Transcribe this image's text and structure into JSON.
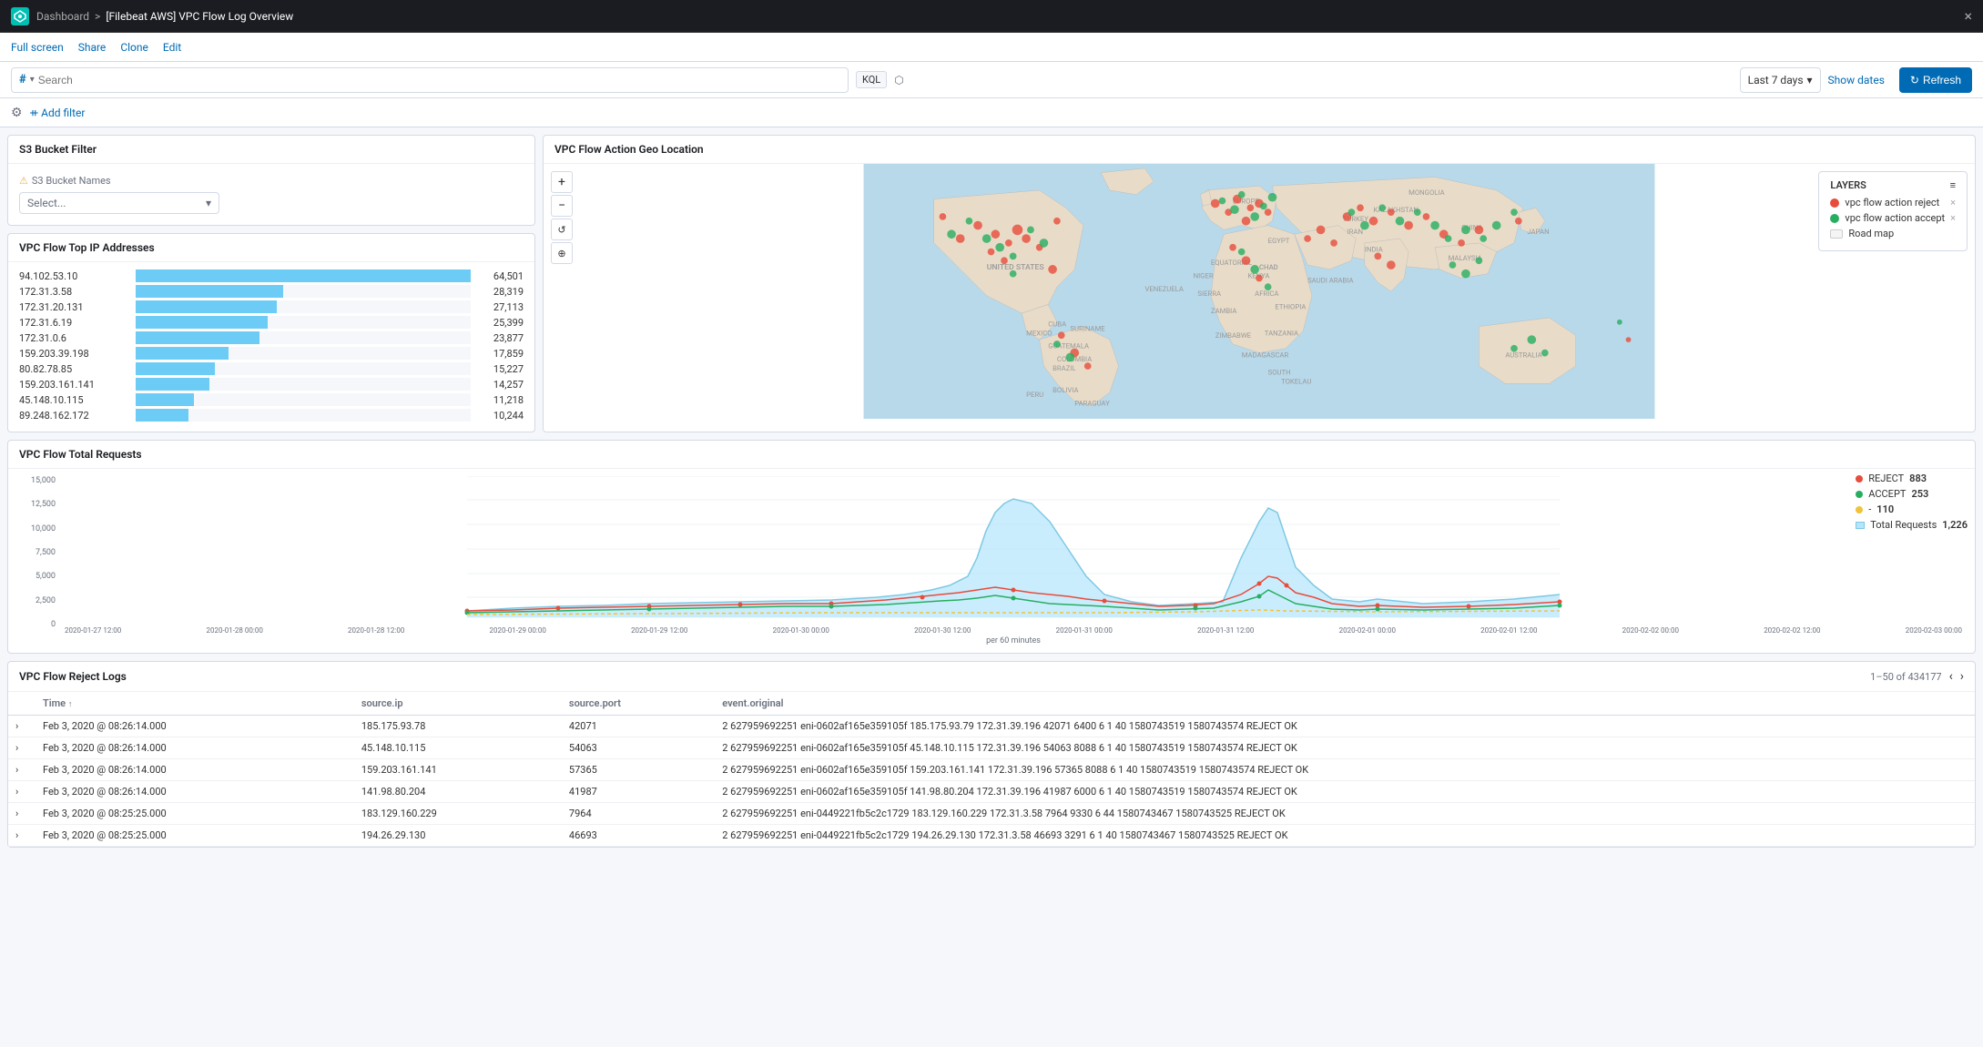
{
  "topbar": {
    "logo_text": "K",
    "breadcrumb1": "Dashboard",
    "separator": ">",
    "breadcrumb2": "[Filebeat AWS] VPC Flow Log Overview",
    "close_icon": "×"
  },
  "secondary_nav": {
    "links": [
      "Full screen",
      "Share",
      "Clone",
      "Edit"
    ]
  },
  "search_bar": {
    "hash_symbol": "#",
    "chevron": "▾",
    "search_placeholder": "Search",
    "kql_label": "KQL",
    "time_range": "Last 7 days",
    "show_dates": "Show dates",
    "refresh": "Refresh"
  },
  "filter_bar": {
    "add_filter_label": "+ Add filter"
  },
  "s3_panel": {
    "title": "S3 Bucket Filter",
    "bucket_label": "S3 Bucket Names",
    "select_placeholder": "Select..."
  },
  "ips_panel": {
    "title": "VPC Flow Top IP Addresses",
    "rows": [
      {
        "ip": "94.102.53.10",
        "value": 64501,
        "bar_pct": 100
      },
      {
        "ip": "172.31.3.58",
        "value": 28319,
        "bar_pct": 44
      },
      {
        "ip": "172.31.20.131",
        "value": 27113,
        "bar_pct": 42
      },
      {
        "ip": "172.31.6.19",
        "value": 25399,
        "bar_pct": 39
      },
      {
        "ip": "172.31.0.6",
        "value": 23877,
        "bar_pct": 37
      },
      {
        "ip": "159.203.39.198",
        "value": 17859,
        "bar_pct": 28
      },
      {
        "ip": "80.82.78.85",
        "value": 15227,
        "bar_pct": 24
      },
      {
        "ip": "159.203.161.141",
        "value": 14257,
        "bar_pct": 22
      },
      {
        "ip": "45.148.10.115",
        "value": 11218,
        "bar_pct": 17
      },
      {
        "ip": "89.248.162.172",
        "value": 10244,
        "bar_pct": 16
      }
    ]
  },
  "map_panel": {
    "title": "VPC Flow Action Geo Location",
    "layers_label": "LAYERS",
    "legend_items": [
      {
        "label": "vpc flow action reject",
        "color": "#e74c3c",
        "type": "reject"
      },
      {
        "label": "vpc flow action accept",
        "color": "#27ae60",
        "type": "accept"
      },
      {
        "label": "Road map",
        "type": "road"
      }
    ],
    "controls": [
      "+",
      "-",
      "↺",
      "⊕"
    ]
  },
  "requests_panel": {
    "title": "VPC Flow Total Requests",
    "legend": [
      {
        "label": "REJECT",
        "value": "883",
        "color": "#e74c3c"
      },
      {
        "label": "ACCEPT",
        "value": "253",
        "color": "#27ae60"
      },
      {
        "label": "-",
        "value": "110",
        "color": "#f0c33c"
      },
      {
        "label": "Total Requests",
        "value": "1,226",
        "color": "#7ec8e3"
      }
    ],
    "y_labels": [
      "15,000",
      "12,500",
      "10,000",
      "7,500",
      "5,000",
      "2,500",
      "0"
    ],
    "x_labels": [
      "2020-01-27 12:00",
      "2020-01-28 00:00",
      "2020-01-28 12:00",
      "2020-01-29 00:00",
      "2020-01-29 12:00",
      "2020-01-30 00:00",
      "2020-01-30 12:00",
      "2020-01-31 00:00",
      "2020-01-31 12:00",
      "2020-02-01 00:00",
      "2020-02-01 12:00",
      "2020-02-02 00:00",
      "2020-02-02 12:00",
      "2020-02-03 00:00"
    ],
    "per_label": "per 60 minutes"
  },
  "logs_panel": {
    "title": "VPC Flow Reject Logs",
    "pagination": "1–50 of 434177",
    "columns": [
      "Time",
      "source.ip",
      "source.port",
      "event.original"
    ],
    "rows": [
      {
        "time": "Feb 3, 2020 @ 08:26:14.000",
        "source_ip": "185.175.93.78",
        "source_port": "42071",
        "event": "2 627959692251 eni-0602af165e359105f 185.175.93.79 172.31.39.196 42071 6400 6 1 40 1580743519 1580743574 REJECT OK"
      },
      {
        "time": "Feb 3, 2020 @ 08:26:14.000",
        "source_ip": "45.148.10.115",
        "source_port": "54063",
        "event": "2 627959692251 eni-0602af165e359105f 45.148.10.115 172.31.39.196 54063 8088 6 1 40 1580743519 1580743574 REJECT OK"
      },
      {
        "time": "Feb 3, 2020 @ 08:26:14.000",
        "source_ip": "159.203.161.141",
        "source_port": "57365",
        "event": "2 627959692251 eni-0602af165e359105f 159.203.161.141 172.31.39.196 57365 8088 6 1 40 1580743519 1580743574 REJECT OK"
      },
      {
        "time": "Feb 3, 2020 @ 08:26:14.000",
        "source_ip": "141.98.80.204",
        "source_port": "41987",
        "event": "2 627959692251 eni-0602af165e359105f 141.98.80.204 172.31.39.196 41987 6000 6 1 40 1580743519 1580743574 REJECT OK"
      },
      {
        "time": "Feb 3, 2020 @ 08:25:25.000",
        "source_ip": "183.129.160.229",
        "source_port": "7964",
        "event": "2 627959692251 eni-0449221fb5c2c1729 183.129.160.229 172.31.3.58 7964 9330 6 44 1580743467 1580743525 REJECT OK"
      },
      {
        "time": "Feb 3, 2020 @ 08:25:25.000",
        "source_ip": "194.26.29.130",
        "source_port": "46693",
        "event": "2 627959692251 eni-0449221fb5c2c1729 194.26.29.130 172.31.3.58 46693 3291 6 1 40 1580743467 1580743525 REJECT OK"
      }
    ]
  }
}
